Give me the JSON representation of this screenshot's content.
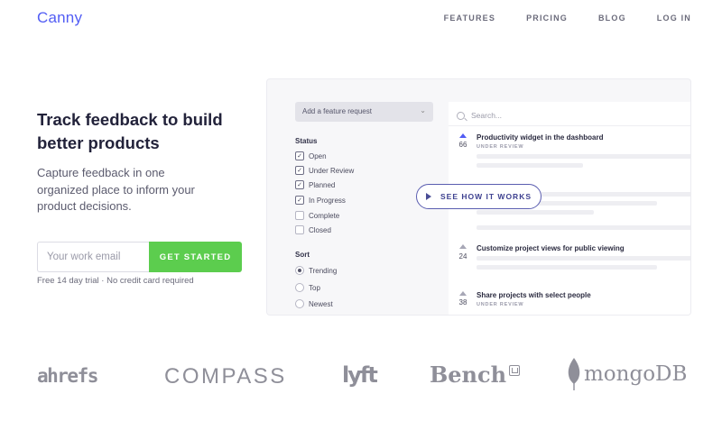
{
  "header": {
    "logo": "Canny",
    "nav": [
      "FEATURES",
      "PRICING",
      "BLOG",
      "LOG IN"
    ]
  },
  "hero": {
    "title": "Track feedback to build better products",
    "subtitle": "Capture feedback in one organized place to inform your product decisions.",
    "email_placeholder": "Your work email",
    "cta_label": "GET STARTED",
    "trial_note": "Free 14 day trial · No credit card required"
  },
  "demo": {
    "add_request": "Add a feature request",
    "status_title": "Status",
    "statuses": [
      {
        "label": "Open",
        "checked": true
      },
      {
        "label": "Under Review",
        "checked": true
      },
      {
        "label": "Planned",
        "checked": true
      },
      {
        "label": "In Progress",
        "checked": true
      },
      {
        "label": "Complete",
        "checked": false
      },
      {
        "label": "Closed",
        "checked": false
      }
    ],
    "sort_title": "Sort",
    "sorts": [
      {
        "label": "Trending",
        "selected": true
      },
      {
        "label": "Top",
        "selected": false
      },
      {
        "label": "Newest",
        "selected": false
      }
    ],
    "search_placeholder": "Search...",
    "posts": [
      {
        "votes": "66",
        "title": "Productivity widget in the dashboard",
        "status": "UNDER REVIEW",
        "voted": true
      },
      {
        "votes": "24",
        "title": "Customize project views for public viewing",
        "status": "",
        "voted": false
      },
      {
        "votes": "38",
        "title": "Share projects with select people",
        "status": "UNDER REVIEW",
        "voted": false
      }
    ],
    "video_button": "SEE HOW IT WORKS"
  },
  "logos": [
    "ahrefs",
    "COMPASS",
    "lyft",
    "Bench",
    "mongoDB"
  ],
  "colors": {
    "brand": "#525df4",
    "cta": "#5ccd4e",
    "logo_gray": "#8f8f99"
  }
}
